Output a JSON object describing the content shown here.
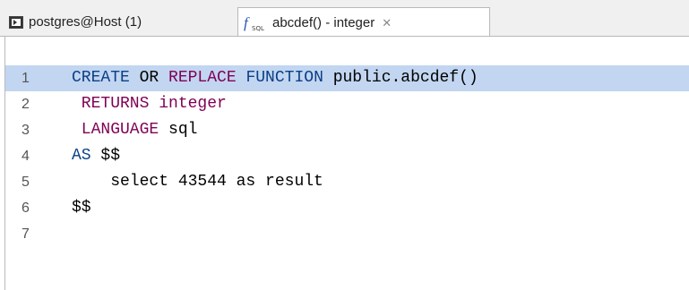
{
  "tabs": [
    {
      "label": "postgres@Host (1)",
      "icon": "console-icon",
      "active": false
    },
    {
      "label": "abcdef() - integer",
      "icon": "function-sql-icon",
      "icon_small_text": "SQL",
      "active": true,
      "close_glyph": "✕"
    }
  ],
  "editor": {
    "current_line": 1,
    "highlight_color": "#c2d6f1",
    "keyword_color": "#7f0055",
    "lines": [
      {
        "number": "1",
        "tokens": [
          {
            "text": "CREATE",
            "kind": "keyword-blue"
          },
          {
            "text": " OR ",
            "kind": "plain"
          },
          {
            "text": "REPLACE",
            "kind": "keyword"
          },
          {
            "text": " FUNCTION ",
            "kind": "keyword-blue"
          },
          {
            "text": "public.abcdef()",
            "kind": "plain"
          }
        ]
      },
      {
        "number": "2",
        "tokens": [
          {
            "text": " RETURNS",
            "kind": "keyword"
          },
          {
            "text": " integer",
            "kind": "keyword"
          }
        ]
      },
      {
        "number": "3",
        "tokens": [
          {
            "text": " LANGUAGE",
            "kind": "keyword"
          },
          {
            "text": " sql",
            "kind": "plain"
          }
        ]
      },
      {
        "number": "4",
        "tokens": [
          {
            "text": "AS ",
            "kind": "keyword-blue"
          },
          {
            "text": "$$",
            "kind": "plain"
          }
        ]
      },
      {
        "number": "5",
        "tokens": [
          {
            "text": "    select 43544 as result",
            "kind": "plain"
          }
        ]
      },
      {
        "number": "6",
        "tokens": [
          {
            "text": "$$",
            "kind": "plain"
          }
        ]
      },
      {
        "number": "7",
        "tokens": []
      }
    ]
  }
}
